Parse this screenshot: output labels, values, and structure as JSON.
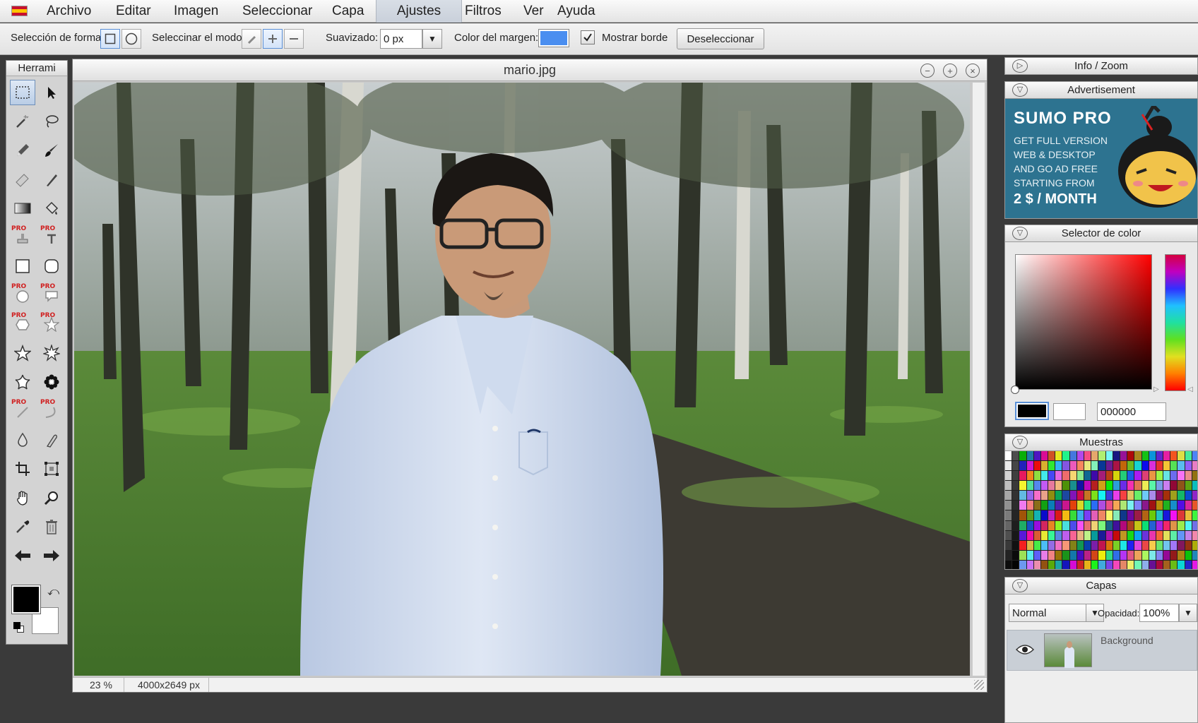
{
  "menu": {
    "items": [
      "Archivo",
      "Editar",
      "Imagen",
      "Seleccionar",
      "Capa",
      "Ajustes",
      "Filtros",
      "Ver",
      "Ayuda"
    ],
    "active": "Ajustes"
  },
  "options": {
    "shape_label": "Selección de forma:",
    "mode_label": "Seleccinar el modo:",
    "smoothing_label": "Suavizado:",
    "smoothing_value": "0 px",
    "border_color_label": "Color del margen:",
    "border_color": "#4a8ef0",
    "show_border_label": "Mostrar borde",
    "show_border_checked": true,
    "deselect_label": "Deseleccionar"
  },
  "tools": {
    "title": "Herrami",
    "pro_badge": "PRO",
    "primary_color": "#000000",
    "secondary_color": "#ffffff"
  },
  "document": {
    "title": "mario.jpg",
    "zoom": "23 %",
    "dimensions": "4000x2649 px"
  },
  "panels": {
    "info_zoom": "Info / Zoom",
    "advertisement": "Advertisement",
    "ad": {
      "brand": "SUMO PRO",
      "line1": "GET FULL VERSION",
      "line2": "WEB & DESKTOP",
      "line3": "AND GO AD FREE",
      "line4": "STARTING FROM",
      "price": "2 $ / MONTH",
      "bg_color": "#2d7390"
    },
    "color_picker": "Selector de color",
    "hex_value": "000000",
    "swatches_title": "Muestras",
    "layers_title": "Capas",
    "blend_mode": "Normal",
    "opacity_label": "Opacidad:",
    "opacity_value": "100%",
    "layer_name": "Background"
  }
}
